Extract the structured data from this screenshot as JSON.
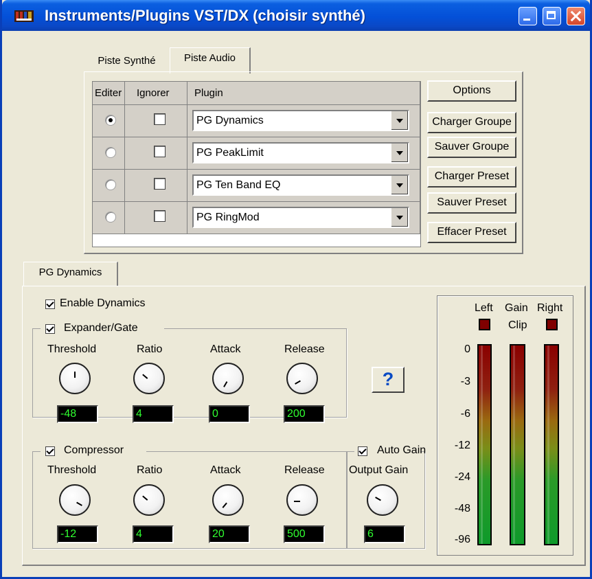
{
  "window": {
    "title": "Instruments/Plugins VST/DX (choisir synthé)"
  },
  "track_tabs": [
    {
      "label": "Piste Synthé"
    },
    {
      "label": "Piste Audio"
    }
  ],
  "grid": {
    "headers": {
      "edit": "Editer",
      "ignore": "Ignorer",
      "plugin": "Plugin"
    },
    "rows": [
      {
        "plugin": "PG Dynamics",
        "selected": true,
        "ignored": false
      },
      {
        "plugin": "PG PeakLimit",
        "selected": false,
        "ignored": false
      },
      {
        "plugin": "PG Ten Band EQ",
        "selected": false,
        "ignored": false
      },
      {
        "plugin": "PG RingMod",
        "selected": false,
        "ignored": false
      }
    ]
  },
  "side_buttons": {
    "options": "Options",
    "load_group": "Charger Groupe",
    "save_group": "Sauver Groupe",
    "load_preset": "Charger Preset",
    "save_preset": "Sauver Preset",
    "clear_preset": "Effacer Preset"
  },
  "plugin_tab": {
    "label": "PG Dynamics"
  },
  "dynamics": {
    "enable": {
      "label": "Enable Dynamics",
      "checked": true
    },
    "expander": {
      "label": "Expander/Gate",
      "checked": true,
      "threshold": {
        "label": "Threshold",
        "value": "-48"
      },
      "ratio": {
        "label": "Ratio",
        "value": "4"
      },
      "attack": {
        "label": "Attack",
        "value": "0"
      },
      "release": {
        "label": "Release",
        "value": "200"
      }
    },
    "compressor": {
      "label": "Compressor",
      "checked": true,
      "threshold": {
        "label": "Threshold",
        "value": "-12"
      },
      "ratio": {
        "label": "Ratio",
        "value": "4"
      },
      "attack": {
        "label": "Attack",
        "value": "20"
      },
      "release": {
        "label": "Release",
        "value": "500"
      }
    },
    "auto_gain": {
      "label": "Auto Gain",
      "checked": true
    },
    "output_gain": {
      "label": "Output Gain",
      "value": "6"
    },
    "help": "?"
  },
  "meters": {
    "left": "Left",
    "gain": "Gain",
    "right": "Right",
    "clip": "Clip",
    "scale": [
      "0",
      "-3",
      "-6",
      "-12",
      "-24",
      "-48",
      "-96"
    ],
    "colors": {
      "top": "#8a0000",
      "mid": "#9a6a10",
      "bottom": "#0e9a2a",
      "led": "#800000",
      "display_text": "#30ff30"
    }
  }
}
